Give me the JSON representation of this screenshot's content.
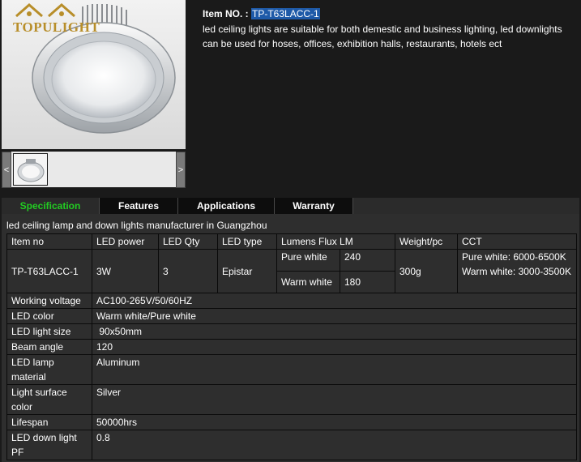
{
  "brand": {
    "logo_text": "TOPULIGHT"
  },
  "gallery": {
    "prev_label": "<",
    "next_label": ">"
  },
  "product": {
    "item_no_label": "Item NO. :",
    "item_no_value": "TP-T63LACC-1",
    "description": "led ceiling lights are suitable for both demestic and business lighting, led downlights can be used for hoses, offices, exhibition halls, restaurants, hotels ect"
  },
  "tabs": [
    {
      "label": "Specification",
      "active": true
    },
    {
      "label": "Features"
    },
    {
      "label": "Applications"
    },
    {
      "label": "Warranty"
    }
  ],
  "spec": {
    "title": "led ceiling lamp and down lights manufacturer in Guangzhou",
    "headers": [
      "Item no",
      "LED power",
      "LED Qty",
      "LED type",
      "Lumens Flux LM",
      "Weight/pc",
      "CCT"
    ],
    "main_row": {
      "item_no": "TP-T63LACC-1",
      "power": "3W",
      "qty": "3",
      "type": "Epistar",
      "lumens": [
        {
          "label": "Pure white",
          "value": "240"
        },
        {
          "label": "Warm white",
          "value": "180"
        }
      ],
      "weight": "300g",
      "cct_pure": "Pure white: 6000-6500K",
      "cct_warm": "Warm white: 3000-3500K"
    },
    "rows": [
      {
        "label": "Working voltage",
        "value": "AC100-265V/50/60HZ"
      },
      {
        "label": "LED color",
        "value": "Warm white/Pure white"
      },
      {
        "label": "LED light size",
        "value": " 90x50mm"
      },
      {
        "label": "Beam angle",
        "value": "120"
      },
      {
        "label": "LED lamp material",
        "value": "Aluminum"
      },
      {
        "label": "Light surface color",
        "value": "Silver"
      },
      {
        "label": "Lifespan",
        "value": "50000hrs"
      },
      {
        "label": "LED down light PF",
        "value": "0.8"
      }
    ]
  }
}
